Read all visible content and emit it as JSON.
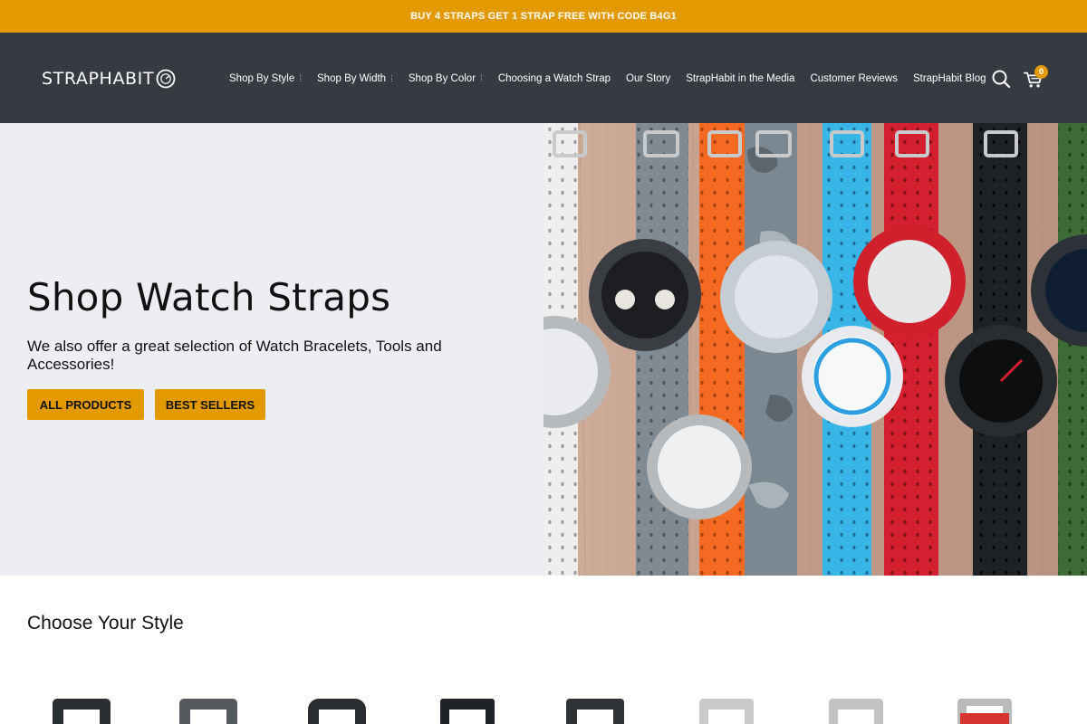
{
  "promo": {
    "text": "BUY 4 STRAPS GET 1 STRAP FREE WITH CODE B4G1"
  },
  "header": {
    "logo_text": "STRAPHABIT",
    "nav": [
      {
        "label": "Shop By Style",
        "has_caret": true
      },
      {
        "label": "Shop By Width",
        "has_caret": true
      },
      {
        "label": "Shop By Color",
        "has_caret": true
      },
      {
        "label": "Choosing a Watch Strap",
        "has_caret": false
      },
      {
        "label": "Our Story",
        "has_caret": false
      },
      {
        "label": "StrapHabit in the Media",
        "has_caret": false
      },
      {
        "label": "Customer Reviews",
        "has_caret": false
      },
      {
        "label": "StrapHabit Blog",
        "has_caret": false
      }
    ],
    "cart_count": "0",
    "icons": [
      "search-icon",
      "cart-icon"
    ]
  },
  "hero": {
    "title": "Shop Watch Straps",
    "subtitle": "We also offer a great selection of Watch Bracelets, Tools and Accessories!",
    "buttons": {
      "all_products": "ALL PRODUCTS",
      "best_sellers": "BEST SELLERS"
    }
  },
  "section": {
    "title": "Choose Your Style"
  },
  "style_thumbnails": [
    {
      "color": "#2a2d31"
    },
    {
      "color": "#55585c"
    },
    {
      "color": "#2a2d31"
    },
    {
      "color": "#1f2226"
    },
    {
      "color": "#2f3236"
    },
    {
      "color": "#c9cacc"
    },
    {
      "color": "#c2c3c5"
    },
    {
      "color": "#d8342f"
    }
  ],
  "colors": {
    "accent": "#e29a00",
    "header_bg": "#363b41",
    "hero_bg": "#eceef3"
  }
}
